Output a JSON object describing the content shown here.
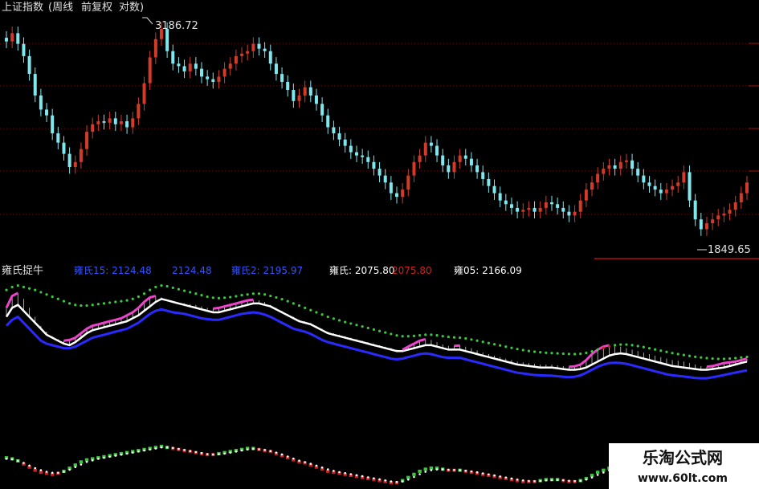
{
  "title_bar": {
    "symbol": "上证指数",
    "period": "(周线",
    "adjust": "前复权",
    "scale": "对数)"
  },
  "annotations": {
    "high_label": "3186.72",
    "low_label": "1849.65"
  },
  "indicator": {
    "name": "雍氏捉牛",
    "readout": [
      {
        "text": "雍氏15: 2124.48",
        "color": "#3355ff"
      },
      {
        "text": "2124.48",
        "color": "#3355ff"
      },
      {
        "text": "雍氏2: 2195.97",
        "color": "#3355ff"
      },
      {
        "text": "雍氏: 2075.80",
        "color": "#ffffff"
      },
      {
        "text": "2075.80",
        "color": "#cc2222"
      },
      {
        "text": "雍05: 2166.09",
        "color": "#ffffff"
      }
    ]
  },
  "watermark": {
    "line1": "乐淘公式网",
    "line2": "www.60lt.com"
  },
  "colors": {
    "up": "#d23a2a",
    "down": "#7fe7ee",
    "band_blue": "#2a2aff",
    "band_white": "#ffffff",
    "band_magenta": "#ee44cc",
    "dots_green": "#3cc83c",
    "dots_red": "#cc2222",
    "grid_red": "#7a0000"
  },
  "chart_data": [
    {
      "type": "candlestick",
      "yscale": "log",
      "ylim": [
        1800,
        3300
      ],
      "max_marker": {
        "value": 3186.72
      },
      "min_marker": {
        "value": 1849.65
      },
      "close": [
        3080,
        3150,
        3060,
        2960,
        2820,
        2660,
        2560,
        2520,
        2400,
        2340,
        2270,
        2190,
        2220,
        2300,
        2410,
        2460,
        2480,
        2470,
        2500,
        2460,
        2480,
        2440,
        2500,
        2600,
        2750,
        2950,
        3100,
        3186.72,
        3000,
        2900,
        2880,
        2840,
        2900,
        2860,
        2800,
        2780,
        2760,
        2800,
        2860,
        2900,
        2960,
        2980,
        3000,
        3060,
        3020,
        3000,
        2900,
        2820,
        2760,
        2700,
        2620,
        2660,
        2720,
        2660,
        2600,
        2520,
        2440,
        2400,
        2360,
        2320,
        2280,
        2260,
        2250,
        2220,
        2180,
        2140,
        2100,
        2040,
        2020,
        2060,
        2140,
        2220,
        2260,
        2340,
        2320,
        2260,
        2200,
        2160,
        2220,
        2260,
        2240,
        2200,
        2160,
        2120,
        2080,
        2040,
        2000,
        1980,
        1960,
        1940,
        1950,
        1960,
        1940,
        1960,
        1990,
        1980,
        1960,
        1940,
        1920,
        1940,
        2000,
        2060,
        2100,
        2150,
        2180,
        2200,
        2180,
        2220,
        2230,
        2180,
        2140,
        2100,
        2080,
        2060,
        2040,
        2060,
        2080,
        2100,
        2160,
        2000,
        1900,
        1849.65,
        1880,
        1900,
        1920,
        1930,
        1950,
        1990,
        2040,
        2100
      ]
    },
    {
      "type": "line",
      "title": "雍氏捉牛",
      "series": [
        {
          "name": "雍氏",
          "values": [
            2240,
            2300,
            2320,
            2280,
            2240,
            2200,
            2160,
            2120,
            2100,
            2080,
            2060,
            2050,
            2070,
            2100,
            2130,
            2150,
            2160,
            2170,
            2180,
            2190,
            2200,
            2210,
            2230,
            2250,
            2280,
            2310,
            2340,
            2360,
            2350,
            2340,
            2330,
            2320,
            2310,
            2300,
            2290,
            2280,
            2270,
            2270,
            2280,
            2290,
            2300,
            2310,
            2320,
            2330,
            2330,
            2320,
            2310,
            2290,
            2270,
            2250,
            2230,
            2210,
            2200,
            2190,
            2170,
            2150,
            2130,
            2120,
            2110,
            2100,
            2090,
            2080,
            2070,
            2060,
            2050,
            2040,
            2030,
            2020,
            2010,
            2010,
            2020,
            2030,
            2040,
            2050,
            2050,
            2040,
            2030,
            2020,
            2020,
            2020,
            2010,
            2000,
            1990,
            1980,
            1970,
            1960,
            1950,
            1940,
            1930,
            1920,
            1915,
            1910,
            1905,
            1900,
            1900,
            1900,
            1895,
            1890,
            1885,
            1885,
            1890,
            1900,
            1920,
            1940,
            1960,
            1980,
            1990,
            1995,
            1990,
            1980,
            1970,
            1960,
            1950,
            1940,
            1930,
            1920,
            1910,
            1905,
            1900,
            1895,
            1890,
            1885,
            1885,
            1890,
            1895,
            1900,
            1910,
            1920,
            1930,
            1940
          ]
        },
        {
          "name": "雍氏15",
          "values": [
            2300,
            2380,
            2400,
            2360,
            2300,
            2240,
            2180,
            2140,
            2110,
            2090,
            2080,
            2085,
            2100,
            2130,
            2160,
            2180,
            2190,
            2200,
            2210,
            2220,
            2230,
            2250,
            2270,
            2300,
            2340,
            2370,
            2380,
            2370,
            2350,
            2340,
            2335,
            2330,
            2325,
            2320,
            2310,
            2300,
            2295,
            2300,
            2310,
            2320,
            2330,
            2340,
            2350,
            2355,
            2350,
            2340,
            2320,
            2300,
            2280,
            2260,
            2240,
            2220,
            2210,
            2200,
            2180,
            2160,
            2140,
            2130,
            2120,
            2110,
            2100,
            2090,
            2080,
            2070,
            2060,
            2050,
            2040,
            2030,
            2020,
            2020,
            2040,
            2060,
            2080,
            2090,
            2085,
            2070,
            2055,
            2045,
            2045,
            2048,
            2040,
            2030,
            2015,
            2000,
            1990,
            1980,
            1970,
            1960,
            1950,
            1940,
            1935,
            1930,
            1925,
            1920,
            1920,
            1920,
            1915,
            1910,
            1905,
            1908,
            1920,
            1950,
            1990,
            2020,
            2040,
            2050,
            2045,
            2040,
            2030,
            2020,
            2010,
            2000,
            1990,
            1980,
            1970,
            1960,
            1950,
            1945,
            1940,
            1930,
            1920,
            1910,
            1905,
            1910,
            1920,
            1930,
            1935,
            1940,
            1950,
            1960
          ]
        },
        {
          "name": "雍氏2",
          "values": [
            2180,
            2220,
            2240,
            2200,
            2160,
            2120,
            2080,
            2060,
            2050,
            2040,
            2030,
            2030,
            2040,
            2060,
            2080,
            2100,
            2110,
            2120,
            2130,
            2140,
            2150,
            2160,
            2180,
            2200,
            2230,
            2260,
            2280,
            2290,
            2280,
            2270,
            2265,
            2260,
            2250,
            2240,
            2230,
            2225,
            2220,
            2220,
            2230,
            2240,
            2250,
            2260,
            2265,
            2270,
            2265,
            2255,
            2240,
            2220,
            2200,
            2180,
            2160,
            2150,
            2140,
            2125,
            2105,
            2085,
            2070,
            2060,
            2050,
            2040,
            2030,
            2020,
            2010,
            2000,
            1990,
            1980,
            1970,
            1960,
            1955,
            1960,
            1970,
            1980,
            1990,
            1995,
            1990,
            1980,
            1970,
            1965,
            1965,
            1965,
            1955,
            1945,
            1935,
            1925,
            1915,
            1905,
            1895,
            1885,
            1875,
            1865,
            1860,
            1855,
            1850,
            1848,
            1846,
            1845,
            1842,
            1838,
            1835,
            1838,
            1848,
            1865,
            1885,
            1905,
            1920,
            1930,
            1932,
            1930,
            1925,
            1915,
            1905,
            1895,
            1885,
            1875,
            1865,
            1855,
            1848,
            1844,
            1840,
            1835,
            1830,
            1828,
            1828,
            1835,
            1842,
            1850,
            1858,
            1866,
            1874,
            1880
          ]
        },
        {
          "name": "雍05",
          "values": [
            2420,
            2440,
            2450,
            2440,
            2430,
            2420,
            2405,
            2390,
            2375,
            2360,
            2345,
            2330,
            2320,
            2315,
            2315,
            2320,
            2325,
            2330,
            2335,
            2340,
            2345,
            2350,
            2360,
            2375,
            2395,
            2420,
            2440,
            2450,
            2445,
            2435,
            2425,
            2415,
            2405,
            2395,
            2385,
            2375,
            2368,
            2365,
            2368,
            2372,
            2378,
            2385,
            2390,
            2395,
            2395,
            2390,
            2380,
            2370,
            2358,
            2345,
            2330,
            2315,
            2300,
            2285,
            2270,
            2255,
            2240,
            2228,
            2216,
            2205,
            2195,
            2185,
            2175,
            2165,
            2155,
            2145,
            2135,
            2125,
            2115,
            2110,
            2110,
            2112,
            2116,
            2120,
            2120,
            2116,
            2110,
            2105,
            2102,
            2100,
            2095,
            2088,
            2080,
            2072,
            2064,
            2056,
            2048,
            2040,
            2032,
            2024,
            2017,
            2011,
            2006,
            2002,
            1999,
            1997,
            1995,
            1993,
            1991,
            1990,
            1992,
            1998,
            2008,
            2020,
            2032,
            2042,
            2050,
            2054,
            2054,
            2050,
            2044,
            2037,
            2029,
            2021,
            2013,
            2005,
            1997,
            1990,
            1984,
            1978,
            1972,
            1967,
            1963,
            1960,
            1958,
            1958,
            1960,
            1963,
            1967,
            1971
          ]
        }
      ]
    },
    {
      "type": "scatter",
      "series": [
        {
          "name": "oscillator",
          "values": [
            0.4,
            0.3,
            0.1,
            -0.2,
            -0.5,
            -0.8,
            -1.0,
            -1.1,
            -1.2,
            -1.1,
            -0.9,
            -0.6,
            -0.3,
            0.0,
            0.2,
            0.3,
            0.4,
            0.5,
            0.6,
            0.7,
            0.8,
            0.9,
            1.0,
            1.1,
            1.2,
            1.3,
            1.4,
            1.5,
            1.4,
            1.3,
            1.2,
            1.1,
            1.0,
            0.9,
            0.8,
            0.7,
            0.7,
            0.8,
            0.9,
            1.0,
            1.1,
            1.2,
            1.3,
            1.3,
            1.2,
            1.1,
            1.0,
            0.8,
            0.6,
            0.4,
            0.2,
            0.0,
            -0.1,
            -0.3,
            -0.5,
            -0.7,
            -0.9,
            -1.0,
            -1.1,
            -1.2,
            -1.3,
            -1.4,
            -1.5,
            -1.6,
            -1.7,
            -1.8,
            -1.9,
            -2.0,
            -2.0,
            -1.8,
            -1.5,
            -1.2,
            -0.9,
            -0.7,
            -0.6,
            -0.6,
            -0.7,
            -0.8,
            -0.8,
            -0.8,
            -0.9,
            -1.0,
            -1.1,
            -1.2,
            -1.3,
            -1.4,
            -1.5,
            -1.6,
            -1.7,
            -1.8,
            -1.9,
            -1.9,
            -1.9,
            -1.8,
            -1.7,
            -1.7,
            -1.7,
            -1.8,
            -1.9,
            -1.9,
            -1.8,
            -1.6,
            -1.3,
            -1.0,
            -0.8,
            -0.6,
            -0.5,
            -0.5,
            -0.6,
            -0.7,
            -0.8,
            -0.9,
            -1.0,
            -1.1,
            -1.2,
            -1.3,
            -1.4,
            -1.5,
            -1.6,
            -1.7,
            -1.8,
            -1.9,
            -2.0,
            -1.9,
            -1.8,
            -1.7,
            -1.6,
            -1.5,
            -1.4,
            -1.3
          ]
        },
        {
          "name": "signal",
          "values": [
            0.3,
            0.25,
            0.1,
            -0.1,
            -0.35,
            -0.6,
            -0.8,
            -0.95,
            -1.05,
            -1.05,
            -0.95,
            -0.75,
            -0.5,
            -0.25,
            0.0,
            0.15,
            0.3,
            0.4,
            0.5,
            0.6,
            0.7,
            0.8,
            0.9,
            1.0,
            1.1,
            1.2,
            1.3,
            1.4,
            1.4,
            1.35,
            1.25,
            1.15,
            1.05,
            0.95,
            0.85,
            0.75,
            0.72,
            0.74,
            0.8,
            0.9,
            1.0,
            1.1,
            1.2,
            1.25,
            1.22,
            1.15,
            1.05,
            0.9,
            0.72,
            0.52,
            0.32,
            0.12,
            -0.02,
            -0.18,
            -0.36,
            -0.54,
            -0.72,
            -0.86,
            -0.98,
            -1.08,
            -1.18,
            -1.28,
            -1.38,
            -1.48,
            -1.58,
            -1.68,
            -1.78,
            -1.88,
            -1.94,
            -1.88,
            -1.7,
            -1.45,
            -1.18,
            -0.95,
            -0.8,
            -0.72,
            -0.72,
            -0.76,
            -0.78,
            -0.8,
            -0.85,
            -0.92,
            -1.0,
            -1.1,
            -1.2,
            -1.3,
            -1.4,
            -1.5,
            -1.6,
            -1.7,
            -1.78,
            -1.84,
            -1.86,
            -1.84,
            -1.78,
            -1.75,
            -1.73,
            -1.76,
            -1.82,
            -1.85,
            -1.82,
            -1.7,
            -1.5,
            -1.25,
            -1.02,
            -0.82,
            -0.66,
            -0.58,
            -0.6,
            -0.66,
            -0.74,
            -0.83,
            -0.92,
            -1.02,
            -1.12,
            -1.22,
            -1.32,
            -1.42,
            -1.52,
            -1.62,
            -1.72,
            -1.82,
            -1.9,
            -1.9,
            -1.84,
            -1.76,
            -1.66,
            -1.56,
            -1.46,
            -1.36
          ]
        }
      ]
    }
  ]
}
